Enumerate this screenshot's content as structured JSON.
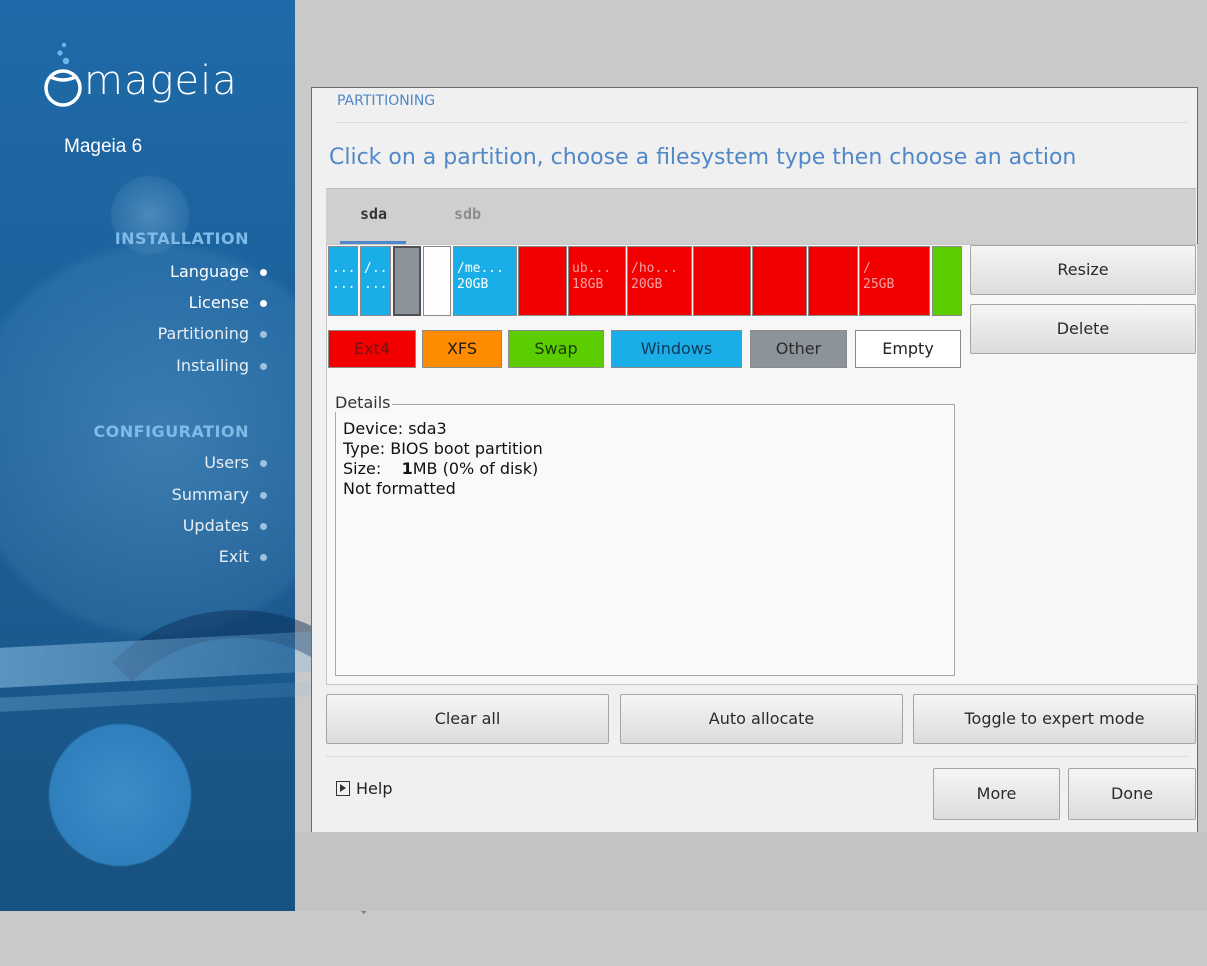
{
  "sidebar": {
    "logo_text": "mageia",
    "product": "Mageia 6",
    "sections": [
      {
        "title": "INSTALLATION",
        "steps": [
          {
            "label": "Language",
            "status": "done"
          },
          {
            "label": "License",
            "status": "done"
          },
          {
            "label": "Partitioning",
            "status": "current"
          },
          {
            "label": "Installing",
            "status": "pending"
          }
        ]
      },
      {
        "title": "CONFIGURATION",
        "steps": [
          {
            "label": "Users",
            "status": "pending"
          },
          {
            "label": "Summary",
            "status": "pending"
          },
          {
            "label": "Updates",
            "status": "pending"
          },
          {
            "label": "Exit",
            "status": "pending"
          }
        ]
      }
    ]
  },
  "dialog": {
    "section_label": "PARTITIONING",
    "headline": "Click on a partition, choose a filesystem type then choose an action",
    "tabs": [
      {
        "label": "sda",
        "active": true
      },
      {
        "label": "sdb",
        "active": false
      }
    ],
    "partitions": [
      {
        "type": "windows",
        "line1": "...",
        "line2": "..."
      },
      {
        "type": "windows",
        "line1": "/...",
        "line2": "..."
      },
      {
        "type": "other",
        "line1": "",
        "line2": "",
        "selected": true
      },
      {
        "type": "empty",
        "line1": "",
        "line2": ""
      },
      {
        "type": "windows",
        "line1": "/me...",
        "line2": "20GB"
      },
      {
        "type": "ext4",
        "line1": "",
        "line2": ""
      },
      {
        "type": "ext4",
        "line1": "ub...",
        "line2": "18GB"
      },
      {
        "type": "ext4",
        "line1": "/ho...",
        "line2": "20GB"
      },
      {
        "type": "ext4",
        "line1": "",
        "line2": ""
      },
      {
        "type": "ext4",
        "line1": "",
        "line2": ""
      },
      {
        "type": "ext4",
        "line1": "",
        "line2": ""
      },
      {
        "type": "ext4",
        "line1": "/",
        "line2": "25GB"
      },
      {
        "type": "swap",
        "line1": "",
        "line2": ""
      }
    ],
    "legend": [
      {
        "label": "Ext4",
        "color": "#f20000",
        "text_color": "#7a1010"
      },
      {
        "label": "XFS",
        "color": "#ff8c00",
        "text_color": "#1a1a1a"
      },
      {
        "label": "Swap",
        "color": "#5ccd00",
        "text_color": "#1a3a00"
      },
      {
        "label": "Windows",
        "color": "#1aaee8",
        "text_color": "#0b3a5a"
      },
      {
        "label": "Other",
        "color": "#8c939a",
        "text_color": "#2b2b2b"
      },
      {
        "label": "Empty",
        "color": "#ffffff",
        "text_color": "#222222"
      }
    ],
    "actions": {
      "resize": "Resize",
      "delete": "Delete"
    },
    "details": {
      "title": "Details",
      "device": "Device: sda3",
      "type": "Type: BIOS boot partition",
      "size_prefix": "Size: ",
      "size_value": "1",
      "size_suffix": "MB (0% of disk)",
      "formatted": "Not formatted"
    },
    "bottom_buttons": {
      "clear_all": "Clear all",
      "auto_allocate": "Auto allocate",
      "toggle_expert": "Toggle to expert mode"
    },
    "help": "Help",
    "more": "More",
    "done": "Done"
  }
}
